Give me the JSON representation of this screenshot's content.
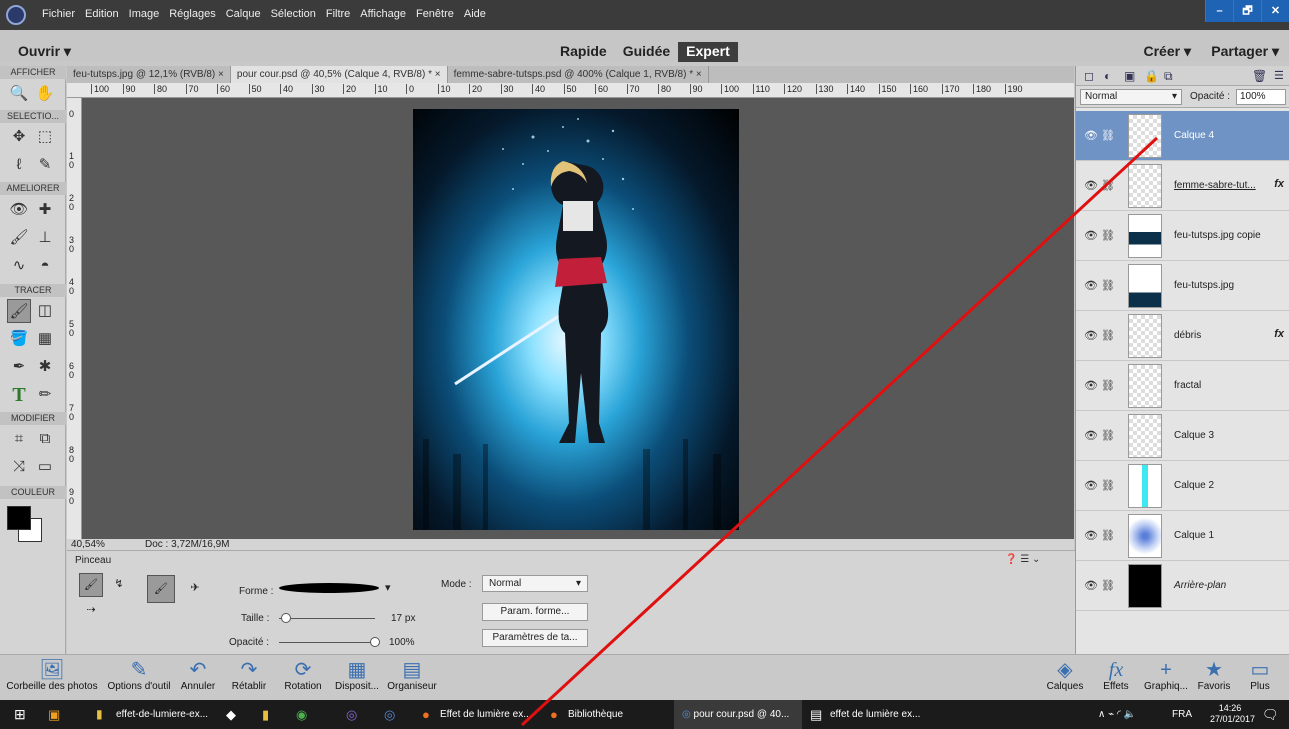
{
  "menu": {
    "items": [
      "Fichier",
      "Edition",
      "Image",
      "Réglages",
      "Calque",
      "Sélection",
      "Filtre",
      "Affichage",
      "Fenêtre",
      "Aide"
    ],
    "window_controls": [
      "–",
      "🗗",
      "✕"
    ]
  },
  "modebar": {
    "open_label": "Ouvrir",
    "modes": [
      "Rapide",
      "Guidée",
      "Expert"
    ],
    "active_mode": "Expert",
    "create_label": "Créer",
    "share_label": "Partager"
  },
  "toolbox": {
    "sections": [
      "AFFICHER",
      "SELECTIO...",
      "AMELIORER",
      "TRACER",
      "MODIFIER",
      "COULEUR"
    ]
  },
  "tabs": [
    {
      "label": "feu-tutsps.jpg @ 12,1% (RVB/8)",
      "close": "×"
    },
    {
      "label": "pour cour.psd @ 40,5% (Calque 4, RVB/8) *",
      "close": "×"
    },
    {
      "label": "femme-sabre-tutsps.psd @ 400% (Calque 1, RVB/8) *",
      "close": "×"
    }
  ],
  "ruler": {
    "h_ticks": [
      "100",
      "90",
      "80",
      "70",
      "60",
      "50",
      "40",
      "30",
      "20",
      "10",
      "0",
      "10",
      "20",
      "30",
      "40",
      "50",
      "60",
      "70",
      "80",
      "90",
      "100",
      "110",
      "120",
      "130",
      "140",
      "150",
      "160",
      "170",
      "180",
      "190"
    ],
    "v_ticks": [
      "0",
      "1\n0",
      "2\n0",
      "3\n0",
      "4\n0",
      "5\n0",
      "6\n0",
      "7\n0",
      "8\n0",
      "9\n0"
    ]
  },
  "status": {
    "zoom": "40,54%",
    "doc": "Doc : 3,72M/16,9M"
  },
  "options": {
    "title": "Pinceau",
    "forme_label": "Forme :",
    "mode_label": "Mode :",
    "mode_value": "Normal",
    "taille_label": "Taille :",
    "taille_value": "17 px",
    "opacite_label": "Opacité :",
    "opacite_value": "100%",
    "taille_fraction": 0.07,
    "opacite_fraction": 1.0,
    "btn_forme": "Param. forme...",
    "btn_tablet": "Paramètres de ta..."
  },
  "layers_panel": {
    "blend_mode": "Normal",
    "opacity_label": "Opacité :",
    "opacity_value": "100%",
    "layers": [
      {
        "name": "Calque 4",
        "selected": true,
        "fx": ""
      },
      {
        "name": "femme-sabre-tut...",
        "selected": false,
        "fx": "fx"
      },
      {
        "name": "feu-tutsps.jpg copie",
        "selected": false,
        "fx": ""
      },
      {
        "name": "feu-tutsps.jpg",
        "selected": false,
        "fx": ""
      },
      {
        "name": "débris",
        "selected": false,
        "fx": "fx"
      },
      {
        "name": "fractal",
        "selected": false,
        "fx": ""
      },
      {
        "name": "Calque 3",
        "selected": false,
        "fx": ""
      },
      {
        "name": "Calque 2",
        "selected": false,
        "fx": ""
      },
      {
        "name": "Calque 1",
        "selected": false,
        "fx": ""
      },
      {
        "name": "Arrière-plan",
        "selected": false,
        "fx": ""
      }
    ]
  },
  "bottombar": {
    "left": [
      "Corbeille des photos",
      "Options d'outil",
      "Annuler",
      "Rétablir",
      "Rotation",
      "Disposit...",
      "Organiseur"
    ],
    "right": [
      "Calques",
      "Effets",
      "Graphiq...",
      "Favoris",
      "Plus"
    ]
  },
  "taskbar": {
    "items": [
      "effet-de-lumiere-ex...",
      "Effet de lumière ex...",
      "Bibliothèque",
      "pour cour.psd @ 40...",
      "effet de lumière ex..."
    ],
    "lang": "FRA",
    "time": "14:26",
    "date": "27/01/2017"
  },
  "colors": {
    "accent": "#6f93c5",
    "annotation_line": "#e01010"
  }
}
